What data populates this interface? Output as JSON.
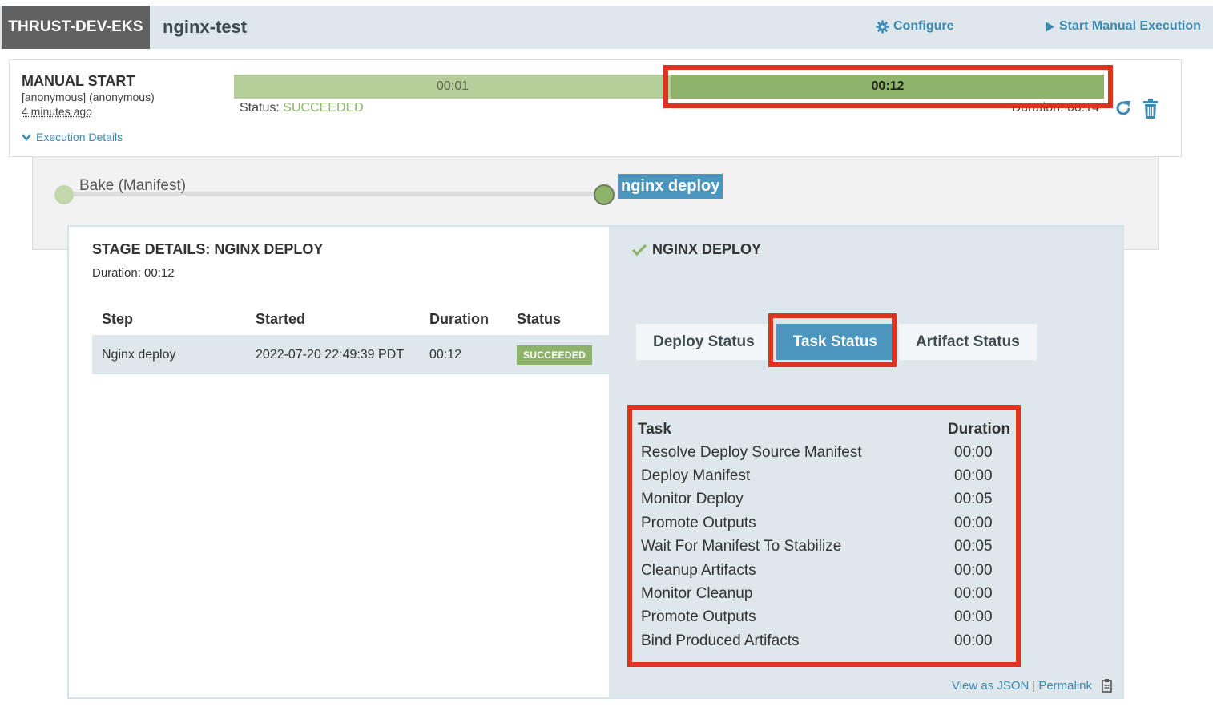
{
  "header": {
    "app_name": "THRUST-DEV-EKS",
    "pipeline_name": "nginx-test",
    "configure_label": "Configure",
    "start_manual_label": "Start Manual Execution"
  },
  "execution": {
    "trigger_title": "MANUAL START",
    "trigger_user": "[anonymous] (anonymous)",
    "trigger_time": "4 minutes ago",
    "details_label": "Execution Details",
    "segments": [
      {
        "label": "00:01"
      },
      {
        "label": "00:12"
      }
    ],
    "status_label": "Status:",
    "status_value": "SUCCEEDED",
    "duration_text": "Duration: 00:14"
  },
  "graph": {
    "stages": [
      {
        "label": "Bake (Manifest)"
      },
      {
        "label": "nginx deploy"
      }
    ]
  },
  "stage_details": {
    "title": "STAGE DETAILS: NGINX DEPLOY",
    "duration": "Duration: 00:12",
    "columns": [
      "Step",
      "Started",
      "Duration",
      "Status"
    ],
    "rows": [
      {
        "step": "Nginx deploy",
        "started": "2022-07-20 22:49:39 PDT",
        "duration": "00:12",
        "status": "SUCCEEDED"
      }
    ]
  },
  "deploy_panel": {
    "title": "NGINX DEPLOY",
    "tabs": [
      "Deploy Status",
      "Task Status",
      "Artifact Status"
    ],
    "active_tab": "Task Status",
    "task_header": {
      "task": "Task",
      "duration": "Duration"
    },
    "tasks": [
      {
        "name": "Resolve Deploy Source Manifest",
        "duration": "00:00"
      },
      {
        "name": "Deploy Manifest",
        "duration": "00:00"
      },
      {
        "name": "Monitor Deploy",
        "duration": "00:05"
      },
      {
        "name": "Promote Outputs",
        "duration": "00:00"
      },
      {
        "name": "Wait For Manifest To Stabilize",
        "duration": "00:05"
      },
      {
        "name": "Cleanup Artifacts",
        "duration": "00:00"
      },
      {
        "name": "Monitor Cleanup",
        "duration": "00:00"
      },
      {
        "name": "Promote Outputs",
        "duration": "00:00"
      },
      {
        "name": "Bind Produced Artifacts",
        "duration": "00:00"
      }
    ],
    "view_json_label": "View as JSON",
    "separator": "|",
    "permalink_label": "Permalink"
  },
  "colors": {
    "accent": "#3d8ab3",
    "success": "#8eb36a",
    "highlight": "#e0321e"
  }
}
